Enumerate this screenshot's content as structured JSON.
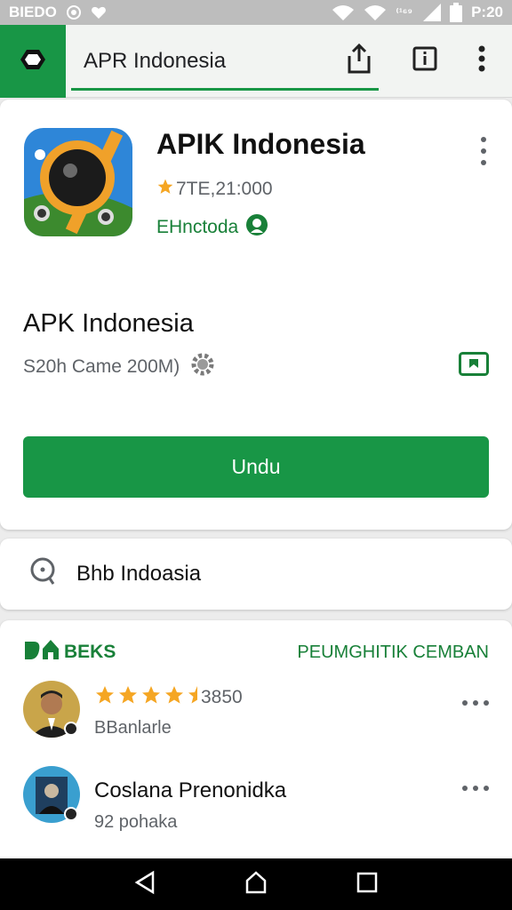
{
  "status_bar": {
    "left_text": "BIEDO",
    "carrier_mark": "⁽¹⁶⁹",
    "time": "P:20",
    "icons": [
      "record-icon",
      "heart-icon",
      "wifi-icon",
      "signal-icon",
      "battery-icon"
    ]
  },
  "app_bar": {
    "search_text": "APR Indonesia",
    "icons": [
      "home-icon",
      "share-icon",
      "info-icon",
      "more-vert-icon"
    ]
  },
  "app": {
    "title": "APIK Indonesia",
    "rating": "7TE,21:000",
    "developer": "EHnctoda",
    "sub_title": "APK Indonesia",
    "meta": "S20h Came 200M)",
    "install_label": "Undu"
  },
  "search_card": {
    "text": "Bhb Indoasia"
  },
  "reviews": {
    "brand_label": "BEKS",
    "link_label": "PEUMGHITIK CEMBAN",
    "items": [
      {
        "score": "3850",
        "sub": "BBanlarle",
        "stars": 4.5
      },
      {
        "name": "Coslana Prenonidka",
        "sub": "92 pohaka"
      }
    ]
  },
  "colors": {
    "accent": "#189646",
    "accent_text": "#188038",
    "star": "#f5a623",
    "status_bar": "#bdbdbd",
    "nav_bar": "#000000"
  }
}
